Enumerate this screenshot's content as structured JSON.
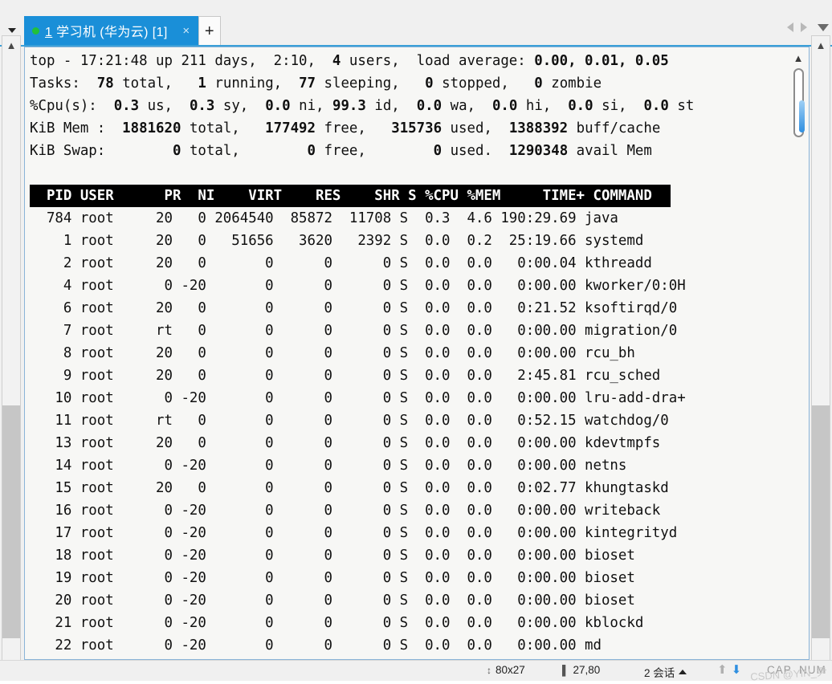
{
  "window": {
    "tab_dropdown_icon": "caret-down-icon",
    "tab": {
      "index_label": "1",
      "title": "学习机 (华为云)",
      "session_badge": "[1]",
      "close_label": "×",
      "status_dot": "connected-green-dot"
    },
    "new_tab_label": "+",
    "nav_prev_icon": "triangle-left-icon",
    "nav_next_icon": "triangle-right-icon",
    "nav_menu_icon": "caret-down-icon"
  },
  "terminal": {
    "header_lines": [
      [
        {
          "t": "top - ",
          "b": false
        },
        {
          "t": "17:21:48",
          "b": false
        },
        {
          "t": " up ",
          "b": false
        },
        {
          "t": "211 days,  2:10",
          "b": false
        },
        {
          "t": ",  ",
          "b": false
        },
        {
          "t": "4",
          "b": true
        },
        {
          "t": " users,  load average: ",
          "b": false
        },
        {
          "t": "0.00, 0.01, 0.05",
          "b": true
        }
      ],
      [
        {
          "t": "Tasks:  ",
          "b": false
        },
        {
          "t": "78",
          "b": true
        },
        {
          "t": " total,   ",
          "b": false
        },
        {
          "t": "1",
          "b": true
        },
        {
          "t": " running,  ",
          "b": false
        },
        {
          "t": "77",
          "b": true
        },
        {
          "t": " sleeping,   ",
          "b": false
        },
        {
          "t": "0",
          "b": true
        },
        {
          "t": " stopped,   ",
          "b": false
        },
        {
          "t": "0",
          "b": true
        },
        {
          "t": " zombie",
          "b": false
        }
      ],
      [
        {
          "t": "%Cpu(s):  ",
          "b": false
        },
        {
          "t": "0.3",
          "b": true
        },
        {
          "t": " us,  ",
          "b": false
        },
        {
          "t": "0.3",
          "b": true
        },
        {
          "t": " sy,  ",
          "b": false
        },
        {
          "t": "0.0",
          "b": true
        },
        {
          "t": " ni, ",
          "b": false
        },
        {
          "t": "99.3",
          "b": true
        },
        {
          "t": " id,  ",
          "b": false
        },
        {
          "t": "0.0",
          "b": true
        },
        {
          "t": " wa,  ",
          "b": false
        },
        {
          "t": "0.0",
          "b": true
        },
        {
          "t": " hi,  ",
          "b": false
        },
        {
          "t": "0.0",
          "b": true
        },
        {
          "t": " si,  ",
          "b": false
        },
        {
          "t": "0.0",
          "b": true
        },
        {
          "t": " st",
          "b": false
        }
      ],
      [
        {
          "t": "KiB Mem :  ",
          "b": false
        },
        {
          "t": "1881620",
          "b": true
        },
        {
          "t": " total,   ",
          "b": false
        },
        {
          "t": "177492",
          "b": true
        },
        {
          "t": " free,   ",
          "b": false
        },
        {
          "t": "315736",
          "b": true
        },
        {
          "t": " used,  ",
          "b": false
        },
        {
          "t": "1388392",
          "b": true
        },
        {
          "t": " buff/cache",
          "b": false
        }
      ],
      [
        {
          "t": "KiB Swap:        ",
          "b": false
        },
        {
          "t": "0",
          "b": true
        },
        {
          "t": " total,        ",
          "b": false
        },
        {
          "t": "0",
          "b": true
        },
        {
          "t": " free,        ",
          "b": false
        },
        {
          "t": "0",
          "b": true
        },
        {
          "t": " used.  ",
          "b": false
        },
        {
          "t": "1290348",
          "b": true
        },
        {
          "t": " avail Mem",
          "b": false
        }
      ]
    ],
    "column_header": "  PID USER      PR  NI    VIRT    RES    SHR S %CPU %MEM     TIME+ COMMAND  ",
    "columns": [
      "PID",
      "USER",
      "PR",
      "NI",
      "VIRT",
      "RES",
      "SHR",
      "S",
      "%CPU",
      "%MEM",
      "TIME+",
      "COMMAND"
    ],
    "rows": [
      {
        "pid": "784",
        "user": "root",
        "pr": "20",
        "ni": "0",
        "virt": "2064540",
        "res": "85872",
        "shr": "11708",
        "s": "S",
        "cpu": "0.3",
        "mem": "4.6",
        "time": "190:29.69",
        "command": "java"
      },
      {
        "pid": "1",
        "user": "root",
        "pr": "20",
        "ni": "0",
        "virt": "51656",
        "res": "3620",
        "shr": "2392",
        "s": "S",
        "cpu": "0.0",
        "mem": "0.2",
        "time": "25:19.66",
        "command": "systemd"
      },
      {
        "pid": "2",
        "user": "root",
        "pr": "20",
        "ni": "0",
        "virt": "0",
        "res": "0",
        "shr": "0",
        "s": "S",
        "cpu": "0.0",
        "mem": "0.0",
        "time": "0:00.04",
        "command": "kthreadd"
      },
      {
        "pid": "4",
        "user": "root",
        "pr": "0",
        "ni": "-20",
        "virt": "0",
        "res": "0",
        "shr": "0",
        "s": "S",
        "cpu": "0.0",
        "mem": "0.0",
        "time": "0:00.00",
        "command": "kworker/0:0H"
      },
      {
        "pid": "6",
        "user": "root",
        "pr": "20",
        "ni": "0",
        "virt": "0",
        "res": "0",
        "shr": "0",
        "s": "S",
        "cpu": "0.0",
        "mem": "0.0",
        "time": "0:21.52",
        "command": "ksoftirqd/0"
      },
      {
        "pid": "7",
        "user": "root",
        "pr": "rt",
        "ni": "0",
        "virt": "0",
        "res": "0",
        "shr": "0",
        "s": "S",
        "cpu": "0.0",
        "mem": "0.0",
        "time": "0:00.00",
        "command": "migration/0"
      },
      {
        "pid": "8",
        "user": "root",
        "pr": "20",
        "ni": "0",
        "virt": "0",
        "res": "0",
        "shr": "0",
        "s": "S",
        "cpu": "0.0",
        "mem": "0.0",
        "time": "0:00.00",
        "command": "rcu_bh"
      },
      {
        "pid": "9",
        "user": "root",
        "pr": "20",
        "ni": "0",
        "virt": "0",
        "res": "0",
        "shr": "0",
        "s": "S",
        "cpu": "0.0",
        "mem": "0.0",
        "time": "2:45.81",
        "command": "rcu_sched"
      },
      {
        "pid": "10",
        "user": "root",
        "pr": "0",
        "ni": "-20",
        "virt": "0",
        "res": "0",
        "shr": "0",
        "s": "S",
        "cpu": "0.0",
        "mem": "0.0",
        "time": "0:00.00",
        "command": "lru-add-dra+"
      },
      {
        "pid": "11",
        "user": "root",
        "pr": "rt",
        "ni": "0",
        "virt": "0",
        "res": "0",
        "shr": "0",
        "s": "S",
        "cpu": "0.0",
        "mem": "0.0",
        "time": "0:52.15",
        "command": "watchdog/0"
      },
      {
        "pid": "13",
        "user": "root",
        "pr": "20",
        "ni": "0",
        "virt": "0",
        "res": "0",
        "shr": "0",
        "s": "S",
        "cpu": "0.0",
        "mem": "0.0",
        "time": "0:00.00",
        "command": "kdevtmpfs"
      },
      {
        "pid": "14",
        "user": "root",
        "pr": "0",
        "ni": "-20",
        "virt": "0",
        "res": "0",
        "shr": "0",
        "s": "S",
        "cpu": "0.0",
        "mem": "0.0",
        "time": "0:00.00",
        "command": "netns"
      },
      {
        "pid": "15",
        "user": "root",
        "pr": "20",
        "ni": "0",
        "virt": "0",
        "res": "0",
        "shr": "0",
        "s": "S",
        "cpu": "0.0",
        "mem": "0.0",
        "time": "0:02.77",
        "command": "khungtaskd"
      },
      {
        "pid": "16",
        "user": "root",
        "pr": "0",
        "ni": "-20",
        "virt": "0",
        "res": "0",
        "shr": "0",
        "s": "S",
        "cpu": "0.0",
        "mem": "0.0",
        "time": "0:00.00",
        "command": "writeback"
      },
      {
        "pid": "17",
        "user": "root",
        "pr": "0",
        "ni": "-20",
        "virt": "0",
        "res": "0",
        "shr": "0",
        "s": "S",
        "cpu": "0.0",
        "mem": "0.0",
        "time": "0:00.00",
        "command": "kintegrityd"
      },
      {
        "pid": "18",
        "user": "root",
        "pr": "0",
        "ni": "-20",
        "virt": "0",
        "res": "0",
        "shr": "0",
        "s": "S",
        "cpu": "0.0",
        "mem": "0.0",
        "time": "0:00.00",
        "command": "bioset"
      },
      {
        "pid": "19",
        "user": "root",
        "pr": "0",
        "ni": "-20",
        "virt": "0",
        "res": "0",
        "shr": "0",
        "s": "S",
        "cpu": "0.0",
        "mem": "0.0",
        "time": "0:00.00",
        "command": "bioset"
      },
      {
        "pid": "20",
        "user": "root",
        "pr": "0",
        "ni": "-20",
        "virt": "0",
        "res": "0",
        "shr": "0",
        "s": "S",
        "cpu": "0.0",
        "mem": "0.0",
        "time": "0:00.00",
        "command": "bioset"
      },
      {
        "pid": "21",
        "user": "root",
        "pr": "0",
        "ni": "-20",
        "virt": "0",
        "res": "0",
        "shr": "0",
        "s": "S",
        "cpu": "0.0",
        "mem": "0.0",
        "time": "0:00.00",
        "command": "kblockd"
      },
      {
        "pid": "22",
        "user": "root",
        "pr": "0",
        "ni": "-20",
        "virt": "0",
        "res": "0",
        "shr": "0",
        "s": "S",
        "cpu": "0.0",
        "mem": "0.0",
        "time": "0:00.00",
        "command": "md"
      }
    ]
  },
  "statusbar": {
    "size_icon": "resize-icon",
    "size_value": "80x27",
    "cursor_icon": "cursor-position-icon",
    "cursor_value": "27,80",
    "sessions_value": "2 会话",
    "sessions_caret_icon": "caret-up-icon",
    "upload_icon": "arrow-up-icon",
    "download_icon": "arrow-down-icon",
    "cap_label": "CAP",
    "num_label": "NUM",
    "watermark": "CSDN @YIN_尹"
  },
  "scrollbars": {
    "left_up_icon": "chevron-up-icon",
    "left_down_icon": "chevron-down-icon",
    "right_up_icon": "chevron-up-icon",
    "right_down_icon": "chevron-down-icon",
    "inner_slider_icon": "chevron-up-icon"
  }
}
